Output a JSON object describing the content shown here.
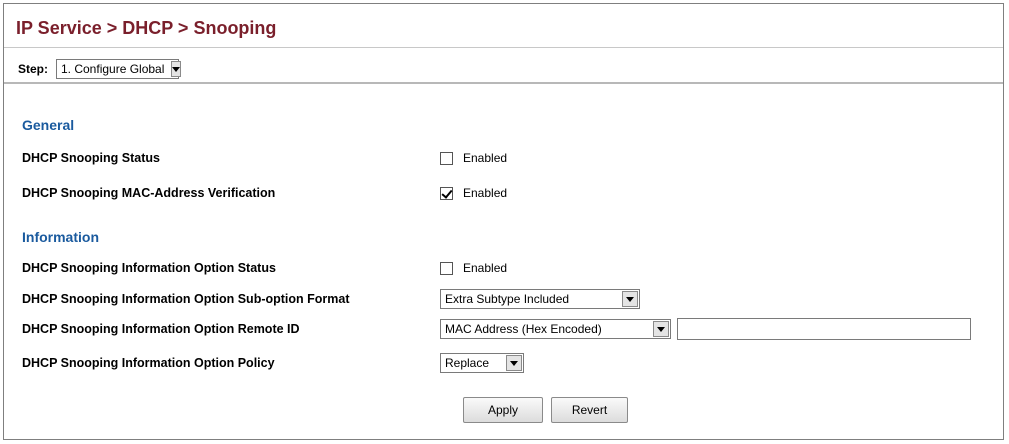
{
  "header": {
    "title": "IP Service > DHCP > Snooping"
  },
  "step": {
    "label": "Step:",
    "value": "1. Configure Global"
  },
  "general": {
    "heading": "General",
    "status": {
      "label": "DHCP Snooping Status",
      "checked": false,
      "text": "Enabled"
    },
    "mac_verification": {
      "label": "DHCP Snooping MAC-Address Verification",
      "checked": true,
      "text": "Enabled"
    }
  },
  "information": {
    "heading": "Information",
    "option_status": {
      "label": "DHCP Snooping Information Option Status",
      "checked": false,
      "text": "Enabled"
    },
    "suboption_format": {
      "label": "DHCP Snooping Information Option Sub-option Format",
      "value": "Extra Subtype Included"
    },
    "remote_id": {
      "label": "DHCP Snooping Information Option Remote ID",
      "value": "MAC Address (Hex Encoded)",
      "text_value": ""
    },
    "policy": {
      "label": "DHCP Snooping Information Option Policy",
      "value": "Replace"
    }
  },
  "buttons": {
    "apply": "Apply",
    "revert": "Revert"
  },
  "colors": {
    "title": "#7a1f2b",
    "section_heading": "#1a5a9e"
  }
}
